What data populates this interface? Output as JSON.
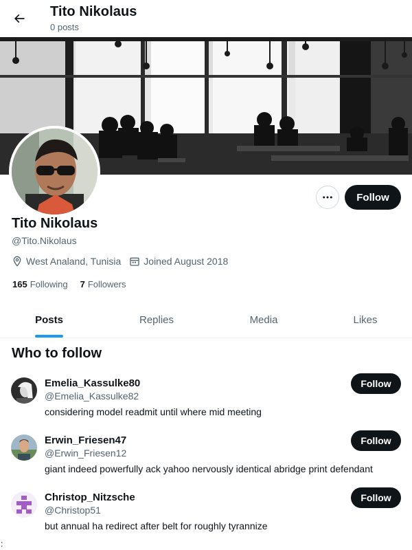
{
  "header": {
    "back_icon": "arrow-left-icon",
    "title": "Tito Nikolaus",
    "post_count": "0 posts"
  },
  "profile": {
    "name": "Tito Nikolaus",
    "handle": "@Tito.Nikolaus",
    "location": "West Analand, Tunisia",
    "joined": "Joined August 2018",
    "following_count": "165",
    "following_label": "Following",
    "followers_count": "7",
    "followers_label": "Followers",
    "more_icon": "more-dots-icon",
    "follow_label": "Follow"
  },
  "tabs": [
    {
      "label": "Posts",
      "active": true
    },
    {
      "label": "Replies",
      "active": false
    },
    {
      "label": "Media",
      "active": false
    },
    {
      "label": "Likes",
      "active": false
    }
  ],
  "who_to_follow": {
    "title": "Who to follow",
    "items": [
      {
        "name": "Emelia_Kassulke80",
        "handle": "@Emelia_Kassulke82",
        "bio": "considering model readmit until where mid meeting",
        "follow_label": "Follow"
      },
      {
        "name": "Erwin_Friesen47",
        "handle": "@Erwin_Friesen12",
        "bio": "giant indeed powerfully ack yahoo nervously identical abridge print defendant",
        "follow_label": "Follow"
      },
      {
        "name": "Christop_Nitzsche",
        "handle": "@Christop51",
        "bio": "but annual ha redirect after belt for roughly tyrannize",
        "follow_label": "Follow"
      }
    ]
  },
  "colors": {
    "accent": "#1d9bf0",
    "text_primary": "#0f1419",
    "text_secondary": "#536471",
    "button_dark": "#0f1419"
  },
  "stray_text": ":"
}
